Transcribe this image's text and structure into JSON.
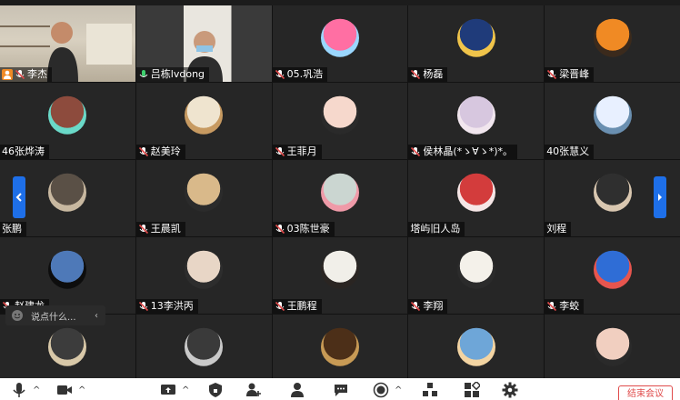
{
  "participants": [
    {
      "name": "李杰",
      "mic": "host-orange"
    },
    {
      "name": "吕栋lvdong",
      "mic": "on"
    },
    {
      "name": "05.巩浩",
      "mic": "muted"
    },
    {
      "name": "杨磊",
      "mic": "muted"
    },
    {
      "name": "梁晋峰",
      "mic": "muted"
    },
    {
      "name": "46张烨涛",
      "mic": "none"
    },
    {
      "name": "赵美玲",
      "mic": "muted"
    },
    {
      "name": "王菲月",
      "mic": "muted"
    },
    {
      "name": "侯林晶(*ゝ∀ゝ*)*。",
      "mic": "muted"
    },
    {
      "name": "40张慧义",
      "mic": "none"
    },
    {
      "name": "张鹏",
      "mic": "none"
    },
    {
      "name": "王晨凯",
      "mic": "muted"
    },
    {
      "name": "03陈世豪",
      "mic": "muted"
    },
    {
      "name": "塔屿旧人岛",
      "mic": "none"
    },
    {
      "name": "刘程",
      "mic": "none"
    },
    {
      "name": "赵建龙",
      "mic": "muted"
    },
    {
      "name": "13李洪丙",
      "mic": "muted"
    },
    {
      "name": "王鹏程",
      "mic": "muted"
    },
    {
      "name": "李翔",
      "mic": "muted"
    },
    {
      "name": "李蛟",
      "mic": "muted"
    },
    {
      "name": "",
      "mic": "none"
    },
    {
      "name": "",
      "mic": "none"
    },
    {
      "name": "",
      "mic": "none"
    },
    {
      "name": "",
      "mic": "none"
    },
    {
      "name": "",
      "mic": "none"
    }
  ],
  "avatar_colors": [
    [
      "#c9c2b4",
      "#d8d0c0"
    ],
    [
      "#e9e6df",
      "#3a3a3a"
    ],
    [
      "#ff6fa3",
      "#9ad7ff"
    ],
    [
      "#1f3b7a",
      "#f0c44a"
    ],
    [
      "#f08a24",
      "#3b2a1c"
    ],
    [
      "#8d4b3d",
      "#6ad9c8"
    ],
    [
      "#efe4cf",
      "#c79a61"
    ],
    [
      "#f6d8cc",
      "#2a2a2a"
    ],
    [
      "#d7c7df",
      "#f1e6ee"
    ],
    [
      "#e8f0ff",
      "#6a8fb0"
    ],
    [
      "#5a5046",
      "#c8b8a0"
    ],
    [
      "#d9b98a",
      "#2b2b2b"
    ],
    [
      "#cbd6d1",
      "#ef9aa8"
    ],
    [
      "#d33c3c",
      "#f6e6e6"
    ],
    [
      "#2f2f2f",
      "#d9c7b0"
    ],
    [
      "#4e79b8",
      "#0d0d0d"
    ],
    [
      "#e8d6c6",
      "#2d2d2d"
    ],
    [
      "#f1efe9",
      "#2a2522"
    ],
    [
      "#f4f1ea",
      "#2b2b2b"
    ],
    [
      "#2f6dd6",
      "#e7554e"
    ],
    [
      "#3c3c3c",
      "#d8c8a8"
    ],
    [
      "#3a3a3a",
      "#c9c9c9"
    ],
    [
      "#4c2f18",
      "#c79a55"
    ],
    [
      "#6ea6d8",
      "#f3d4a2"
    ],
    [
      "#f1cfc0",
      "#2a2a2a"
    ]
  ],
  "chat": {
    "placeholder": "说点什么..."
  },
  "toolbar": {
    "end_meeting_label": "结束会议",
    "icons": [
      "mic-icon",
      "camera-icon",
      "share-screen-icon",
      "security-icon",
      "invite-icon",
      "participants-icon",
      "chat-icon",
      "record-icon",
      "layout-icon",
      "apps-icon",
      "settings-icon"
    ]
  },
  "colors": {
    "accent": "#1e6fe8",
    "active_border": "#2e9d4b",
    "end_button": "#e04b4b",
    "muted_red": "#e04b4b"
  }
}
